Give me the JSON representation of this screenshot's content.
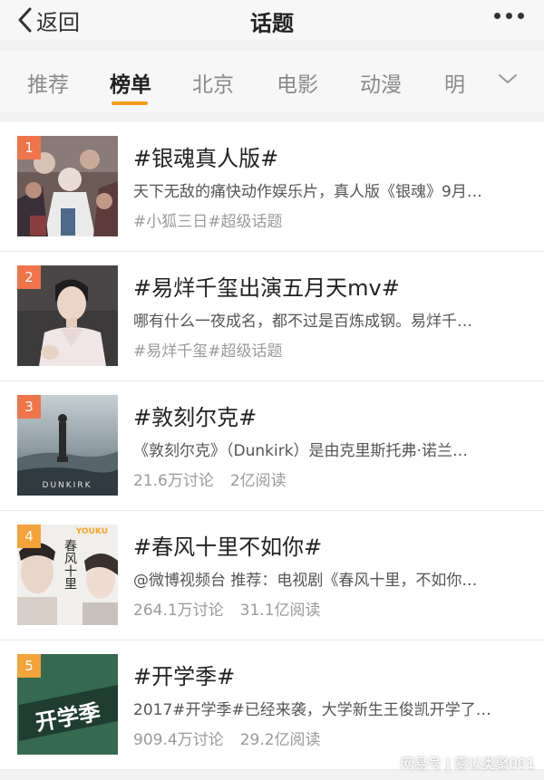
{
  "nav": {
    "back_label": "返回",
    "title": "话题"
  },
  "tabs": [
    "推荐",
    "榜单",
    "北京",
    "电影",
    "动漫",
    "明"
  ],
  "active_tab": 1,
  "accent_color": "#f39c12",
  "items": [
    {
      "rank": "1",
      "rank_color": "#f0744a",
      "title": "#银魂真人版#",
      "desc": "天下无敌的痛快动作娱乐片，真人版《银魂》9月…",
      "meta": [
        "#小狐三日#超级话题"
      ]
    },
    {
      "rank": "2",
      "rank_color": "#f0744a",
      "title": "#易烊千玺出演五月天mv#",
      "desc": "哪有什么一夜成名，都不过是百炼成钢。易烊千…",
      "meta": [
        "#易烊千玺#超级话题"
      ]
    },
    {
      "rank": "3",
      "rank_color": "#f0744a",
      "title": "#敦刻尔克#",
      "desc": "《敦刻尔克》（Dunkirk）是由克里斯托弗·诺兰…",
      "meta": [
        "21.6万讨论",
        "2亿阅读"
      ],
      "poster_text": "DUNKIRK"
    },
    {
      "rank": "4",
      "rank_color": "#f3a33a",
      "title": "#春风十里不如你#",
      "desc": "@微博视频台 推荐：电视剧《春风十里，不如你…",
      "meta": [
        "264.1万讨论",
        "31.1亿阅读"
      ],
      "poster_text": "YOUKU",
      "poster_title": "春风十里"
    },
    {
      "rank": "5",
      "rank_color": "#f3a33a",
      "title": "#开学季#",
      "desc": "2017#开学季#已经来袭，大学新生王俊凯开学了…",
      "meta": [
        "909.4万讨论",
        "29.2亿阅读"
      ],
      "poster_text": "开学季"
    }
  ],
  "watermark": "网易号 | 雾以类聚001"
}
